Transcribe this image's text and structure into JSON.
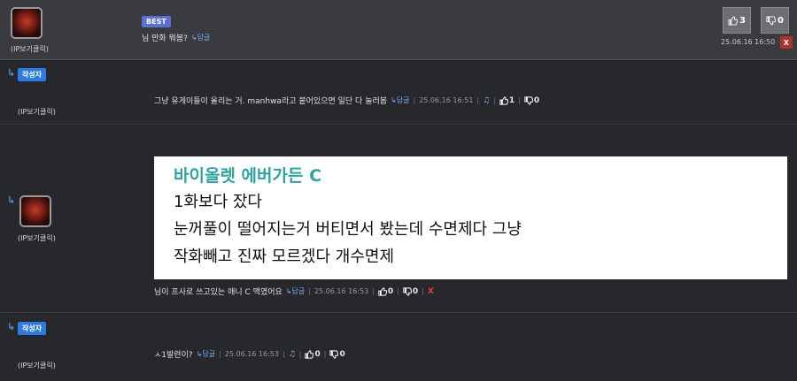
{
  "colors": {
    "accent_blue": "#2c7be5",
    "best_purple": "#5b6fd8",
    "delete_red": "#e0433a",
    "title_teal": "#2aa6a0"
  },
  "best": {
    "ip_label": "(IP보기클릭)",
    "badge": "BEST",
    "text": "님 만화 뭐봄?",
    "reply": "↳답글",
    "up_votes": "3",
    "down_votes": "0",
    "time": "25.06.16 16:50",
    "delete": "X"
  },
  "comment2": {
    "arrow": "↳",
    "badge": "작성자",
    "ip_label": "(IP보기클릭)",
    "text": "그냥 유게이들이 올리는 거. manhwa라고 붙어있으면 일단 다 눌러봄",
    "reply": "↳답글",
    "time": "25.06.16 16:51",
    "up_votes": "1",
    "down_votes": "0"
  },
  "comment3": {
    "arrow": "↳",
    "ip_label": "(IP보기클릭)",
    "image_lines": {
      "title": "바이올렛 에버가든 C",
      "line1": "1화보다 잤다",
      "line2": "눈꺼풀이 떨어지는거 버티면서 봤는데 수면제다 그냥",
      "line3": "작화빼고 진짜 모르겠다 개수면제"
    },
    "text": "님이 프사로 쓰고있는 애니 C 맥였어요",
    "reply": "↳답글",
    "time": "25.06.16 16:53",
    "up_votes": "0",
    "down_votes": "0",
    "delete": "X"
  },
  "comment4": {
    "arrow": "↳",
    "badge": "작성자",
    "ip_label": "(IP보기클릭)",
    "text": "ㅅ1발련이?",
    "reply": "↳답글",
    "time": "25.06.16 16:53",
    "up_votes": "0",
    "down_votes": "0"
  },
  "icons": {
    "thumb_up": "thumbs-up-icon",
    "thumb_down": "thumbs-down-icon",
    "bell": "bell-icon"
  }
}
